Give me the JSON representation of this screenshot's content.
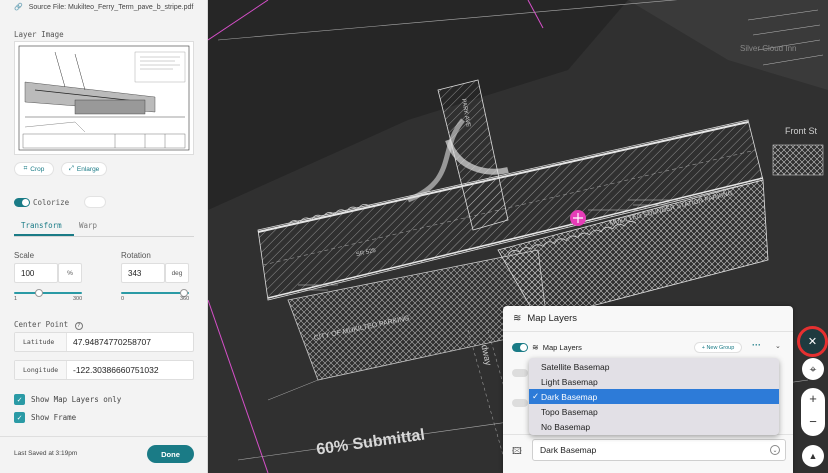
{
  "sidebar": {
    "source_file": "Source File: Mukilteo_Ferry_Term_pave_b_stripe.pdf",
    "layer_image_label": "Layer Image",
    "crop_label": "Crop",
    "enlarge_label": "Enlarge",
    "colorize_label": "Colorize",
    "tabs": [
      {
        "label": "Transform",
        "active": true
      },
      {
        "label": "Warp",
        "active": false
      }
    ],
    "scale": {
      "label": "Scale",
      "value": "100",
      "unit": "%",
      "min": "1",
      "max": "300"
    },
    "rotation": {
      "label": "Rotation",
      "value": "343",
      "unit": "deg",
      "min": "0",
      "max": "360"
    },
    "center_point_label": "Center Point",
    "latitude": {
      "label": "Latitude",
      "value": "47.94874770258707"
    },
    "longitude": {
      "label": "Longitude",
      "value": "-122.30386660751032"
    },
    "show_map_layers_only": "Show Map Layers only",
    "show_frame": "Show Frame",
    "last_saved": "Last Saved at 3:19pm",
    "done_label": "Done"
  },
  "map": {
    "labels": {
      "silver_cloud_inn": "Silver Cloud Inn",
      "front_st": "Front St",
      "subtitle_text": "60% Submittal",
      "station_parking": "MUKILTEO SOUNDER STATION PARKING",
      "city_parking": "CITY OF MUKILTEO PARKING",
      "park_ave": "PARK AVE",
      "sr525": "SR 525",
      "railway": "dway"
    }
  },
  "layers_panel": {
    "title": "Map Layers",
    "group_name": "Map Layers",
    "new_group_label": "+ New Group",
    "basemap_selected": "Dark Basemap",
    "basemap_options": [
      {
        "label": "Satellite Basemap",
        "selected": false
      },
      {
        "label": "Light Basemap",
        "selected": false
      },
      {
        "label": "Dark Basemap",
        "selected": true
      },
      {
        "label": "Topo Basemap",
        "selected": false
      },
      {
        "label": "No Basemap",
        "selected": false
      }
    ]
  },
  "colors": {
    "accent": "#1a7b86",
    "selection_blue": "#2d7bd8",
    "map_bg": "#303030",
    "highlight_ring": "#e53030"
  }
}
